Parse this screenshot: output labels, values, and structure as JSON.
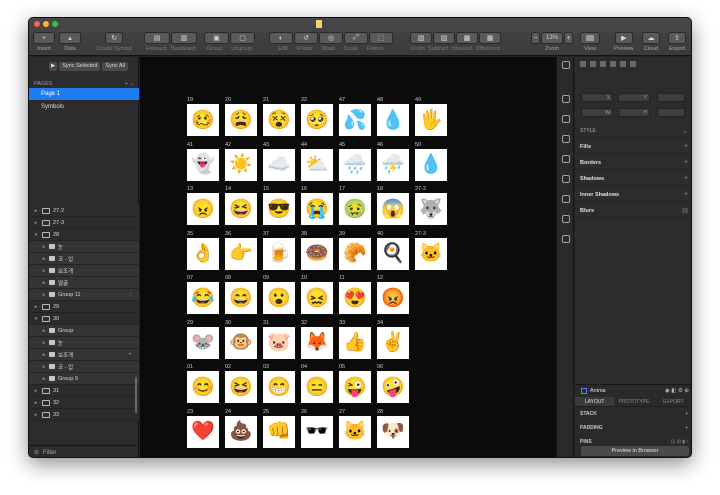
{
  "toolbar": {
    "items": [
      {
        "label": "Insert",
        "glyph": "+",
        "dim": false
      },
      {
        "label": "Data",
        "glyph": "▴",
        "dim": false
      },
      {
        "label": "Create Symbol",
        "glyph": "↻",
        "dim": true
      },
      {
        "label": "Forward",
        "glyph": "▤",
        "dim": true
      },
      {
        "label": "Backward",
        "glyph": "▥",
        "dim": true
      },
      {
        "label": "Group",
        "glyph": "▣",
        "dim": true
      },
      {
        "label": "Ungroup",
        "glyph": "▢",
        "dim": true
      },
      {
        "label": "Edit",
        "glyph": "◐",
        "dim": true
      },
      {
        "label": "Rotate",
        "glyph": "↺",
        "dim": true
      },
      {
        "label": "Mask",
        "glyph": "◎",
        "dim": true
      },
      {
        "label": "Scale",
        "glyph": "⤢",
        "dim": true
      },
      {
        "label": "Flatten",
        "glyph": "⬚",
        "dim": true
      },
      {
        "label": "Union",
        "glyph": "▧",
        "dim": true
      },
      {
        "label": "Subtract",
        "glyph": "▨",
        "dim": true
      },
      {
        "label": "Intersect",
        "glyph": "▩",
        "dim": true
      },
      {
        "label": "Difference",
        "glyph": "▦",
        "dim": true
      }
    ],
    "zoom": {
      "label": "Zoom",
      "value": "13%"
    },
    "view_label": "View",
    "preview_label": "Preview",
    "cloud_label": "Cloud",
    "export_label": "Export"
  },
  "left_panel": {
    "sync_selected": "Sync Selected",
    "sync_all": "Sync All",
    "pages_header": "PAGES",
    "pages": [
      {
        "label": "Page 1",
        "selected": true
      },
      {
        "label": "Symbols",
        "selected": false
      }
    ],
    "layers": [
      {
        "name": "27-2",
        "kind": "artboard",
        "open": false
      },
      {
        "name": "27-3",
        "kind": "artboard",
        "open": false
      },
      {
        "name": "28",
        "kind": "artboard",
        "open": true
      },
      {
        "name": "눈",
        "kind": "child",
        "tail": ""
      },
      {
        "name": "코 - 입",
        "kind": "child",
        "tail": ""
      },
      {
        "name": "보조개",
        "kind": "child",
        "tail": ""
      },
      {
        "name": "얼굴",
        "kind": "child",
        "tail": ""
      },
      {
        "name": "Group 11",
        "kind": "child",
        "tail": "◌"
      },
      {
        "name": "29",
        "kind": "artboard",
        "open": false
      },
      {
        "name": "30",
        "kind": "artboard",
        "open": true
      },
      {
        "name": "Group",
        "kind": "child",
        "tail": ""
      },
      {
        "name": "눈",
        "kind": "child",
        "tail": ""
      },
      {
        "name": "보조개",
        "kind": "child",
        "tail": "•"
      },
      {
        "name": "코 - 입",
        "kind": "child",
        "tail": ""
      },
      {
        "name": "Group 9",
        "kind": "child",
        "tail": ""
      },
      {
        "name": "31",
        "kind": "artboard",
        "open": false
      },
      {
        "name": "32",
        "kind": "artboard",
        "open": false
      },
      {
        "name": "33",
        "kind": "artboard",
        "open": false
      }
    ],
    "filter_label": "Filter"
  },
  "canvas": {
    "cells": [
      {
        "num": "19",
        "emoji": "🥴",
        "row": 0,
        "col": 0
      },
      {
        "num": "20",
        "emoji": "😩",
        "row": 0,
        "col": 1
      },
      {
        "num": "21",
        "emoji": "😵",
        "row": 0,
        "col": 2
      },
      {
        "num": "22",
        "emoji": "🥺",
        "row": 0,
        "col": 3
      },
      {
        "num": "47",
        "emoji": "💦",
        "row": 0,
        "col": 4
      },
      {
        "num": "48",
        "emoji": "💧",
        "row": 0,
        "col": 5
      },
      {
        "num": "49",
        "emoji": "🖐",
        "row": 0,
        "col": 6
      },
      {
        "num": "41",
        "emoji": "👻",
        "row": 1,
        "col": 0
      },
      {
        "num": "42",
        "emoji": "☀️",
        "row": 1,
        "col": 1
      },
      {
        "num": "43",
        "emoji": "☁️",
        "row": 1,
        "col": 2
      },
      {
        "num": "44",
        "emoji": "⛅",
        "row": 1,
        "col": 3
      },
      {
        "num": "45",
        "emoji": "🌧️",
        "row": 1,
        "col": 4
      },
      {
        "num": "46",
        "emoji": "⛈️",
        "row": 1,
        "col": 5
      },
      {
        "num": "50",
        "emoji": "💧",
        "row": 1,
        "col": 6
      },
      {
        "num": "13",
        "emoji": "😠",
        "row": 2,
        "col": 0
      },
      {
        "num": "14",
        "emoji": "😆",
        "row": 2,
        "col": 1
      },
      {
        "num": "15",
        "emoji": "😎",
        "row": 2,
        "col": 2
      },
      {
        "num": "16",
        "emoji": "😭",
        "row": 2,
        "col": 3
      },
      {
        "num": "17",
        "emoji": "🤢",
        "row": 2,
        "col": 4
      },
      {
        "num": "18",
        "emoji": "😱",
        "row": 2,
        "col": 5
      },
      {
        "num": "27-2",
        "emoji": "🐺",
        "row": 2,
        "col": 6
      },
      {
        "num": "35",
        "emoji": "👌",
        "row": 3,
        "col": 0
      },
      {
        "num": "36",
        "emoji": "👉",
        "row": 3,
        "col": 1
      },
      {
        "num": "37",
        "emoji": "🍺",
        "row": 3,
        "col": 2
      },
      {
        "num": "38",
        "emoji": "🍩",
        "row": 3,
        "col": 3
      },
      {
        "num": "39",
        "emoji": "🥐",
        "row": 3,
        "col": 4
      },
      {
        "num": "40",
        "emoji": "🍳",
        "row": 3,
        "col": 5
      },
      {
        "num": "27-3",
        "emoji": "🐱",
        "row": 3,
        "col": 6
      },
      {
        "num": "07",
        "emoji": "😂",
        "row": 4,
        "col": 0
      },
      {
        "num": "08",
        "emoji": "😄",
        "row": 4,
        "col": 1
      },
      {
        "num": "09",
        "emoji": "😮",
        "row": 4,
        "col": 2
      },
      {
        "num": "10",
        "emoji": "😖",
        "row": 4,
        "col": 3
      },
      {
        "num": "11",
        "emoji": "😍",
        "row": 4,
        "col": 4
      },
      {
        "num": "12",
        "emoji": "😡",
        "row": 4,
        "col": 5
      },
      {
        "num": "29",
        "emoji": "🐭",
        "row": 5,
        "col": 0
      },
      {
        "num": "30",
        "emoji": "🐵",
        "row": 5,
        "col": 1
      },
      {
        "num": "31",
        "emoji": "🐷",
        "row": 5,
        "col": 2
      },
      {
        "num": "32",
        "emoji": "🦊",
        "row": 5,
        "col": 3
      },
      {
        "num": "33",
        "emoji": "👍",
        "row": 5,
        "col": 4
      },
      {
        "num": "34",
        "emoji": "✌️",
        "row": 5,
        "col": 5
      },
      {
        "num": "01",
        "emoji": "😊",
        "row": 6,
        "col": 0
      },
      {
        "num": "02",
        "emoji": "😆",
        "row": 6,
        "col": 1
      },
      {
        "num": "03",
        "emoji": "😁",
        "row": 6,
        "col": 2
      },
      {
        "num": "04",
        "emoji": "😑",
        "row": 6,
        "col": 3
      },
      {
        "num": "05",
        "emoji": "😜",
        "row": 6,
        "col": 4
      },
      {
        "num": "06",
        "emoji": "🤪",
        "row": 6,
        "col": 5
      },
      {
        "num": "23",
        "emoji": "❤️",
        "row": 7,
        "col": 0
      },
      {
        "num": "24",
        "emoji": "💩",
        "row": 7,
        "col": 1
      },
      {
        "num": "25",
        "emoji": "👊",
        "row": 7,
        "col": 2
      },
      {
        "num": "26",
        "emoji": "🕶️",
        "row": 7,
        "col": 3
      },
      {
        "num": "27",
        "emoji": "🐱",
        "row": 7,
        "col": 4
      },
      {
        "num": "28",
        "emoji": "🐶",
        "row": 7,
        "col": 5
      }
    ]
  },
  "inspector": {
    "fields": [
      "X",
      "Y",
      "W",
      "H"
    ],
    "style_header": "STYLE",
    "sections": [
      "Fills",
      "Borders",
      "Shadows",
      "Inner Shadows",
      "Blurs"
    ],
    "anima": {
      "title": "Anima",
      "tabs": [
        "LAYOUT",
        "PROTOTYPE",
        "EXPORT"
      ],
      "rows": [
        "STACK",
        "PADDING",
        "PINS"
      ],
      "preview_button": "Preview in Browser"
    }
  },
  "colors": {
    "accent": "#1e7cf2",
    "canvas": "#0b0b0c",
    "close": "#fc5f57",
    "minimize": "#fdbc2e",
    "maximize": "#28c840"
  }
}
